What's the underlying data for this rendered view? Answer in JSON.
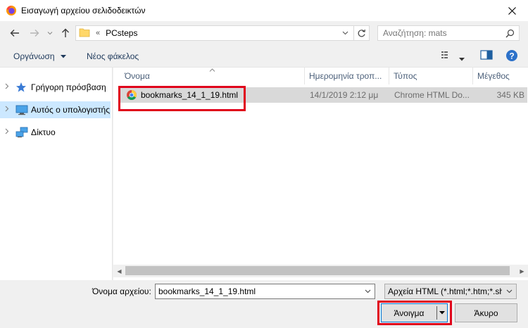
{
  "window": {
    "title": "Εισαγωγή αρχείου σελιδοδεικτών",
    "close_glyph": "✕"
  },
  "address": {
    "overflow": "«",
    "crumb": "PCsteps"
  },
  "search": {
    "placeholder": "Αναζήτηση: mats"
  },
  "toolbar": {
    "organize": "Οργάνωση",
    "new_folder": "Νέος φάκελος"
  },
  "nav": {
    "items": [
      {
        "label": "Γρήγορη πρόσβαση",
        "icon": "star-icon"
      },
      {
        "label": "Αυτός ο υπολογιστής",
        "icon": "computer-icon",
        "selected": true
      },
      {
        "label": "Δίκτυο",
        "icon": "network-icon"
      }
    ]
  },
  "columns": {
    "name": "Όνομα",
    "date": "Ημερομηνία τροπ...",
    "type": "Τύπος",
    "size": "Μέγεθος"
  },
  "files": [
    {
      "name": "bookmarks_14_1_19.html",
      "date": "14/1/2019 2:12 μμ",
      "type": "Chrome HTML Do...",
      "size": "345 KB"
    }
  ],
  "filename": {
    "label": "Όνομα αρχείου:",
    "value": "bookmarks_14_1_19.html"
  },
  "filter": {
    "selected": "Αρχεία HTML (*.html;*.htm;*.sh"
  },
  "buttons": {
    "open": "Άνοιγμα",
    "cancel": "Άκυρο"
  },
  "colors": {
    "highlight": "#e0001b",
    "selection": "#cce8ff",
    "accent": "#0078d7"
  }
}
